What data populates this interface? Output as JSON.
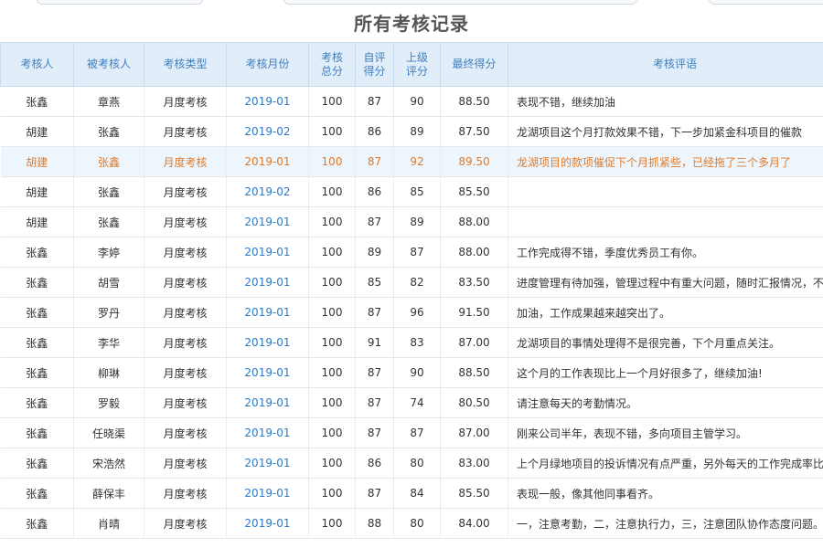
{
  "page": {
    "title": "所有考核记录"
  },
  "colors": {
    "header_bg": "#e1eefa",
    "header_text": "#3f7fbf",
    "month_link": "#2e7bc4",
    "highlight_text": "#e07a2a",
    "highlight_bg": "#eef6fd"
  },
  "table": {
    "headers": {
      "assessor": "考核人",
      "assessee": "被考核人",
      "type": "考核类型",
      "month": "考核月份",
      "total_1": "考核",
      "total_2": "总分",
      "self_1": "自评",
      "self_2": "得分",
      "sup_1": "上级",
      "sup_2": "评分",
      "final": "最终得分",
      "comment": "考核评语"
    },
    "rows": [
      {
        "assessor": "张鑫",
        "assessee": "章燕",
        "type": "月度考核",
        "month": "2019-01",
        "total": "100",
        "self": "87",
        "sup": "90",
        "final": "88.50",
        "comment": "表现不错，继续加油"
      },
      {
        "assessor": "胡建",
        "assessee": "张鑫",
        "type": "月度考核",
        "month": "2019-02",
        "total": "100",
        "self": "86",
        "sup": "89",
        "final": "87.50",
        "comment": "龙湖项目这个月打款效果不错，下一步加紧金科项目的催款"
      },
      {
        "assessor": "胡建",
        "assessee": "张鑫",
        "type": "月度考核",
        "month": "2019-01",
        "total": "100",
        "self": "87",
        "sup": "92",
        "final": "89.50",
        "comment": "龙湖项目的款项催促下个月抓紧些，已经拖了三个多月了"
      },
      {
        "assessor": "胡建",
        "assessee": "张鑫",
        "type": "月度考核",
        "month": "2019-02",
        "total": "100",
        "self": "86",
        "sup": "85",
        "final": "85.50",
        "comment": ""
      },
      {
        "assessor": "胡建",
        "assessee": "张鑫",
        "type": "月度考核",
        "month": "2019-01",
        "total": "100",
        "self": "87",
        "sup": "89",
        "final": "88.00",
        "comment": ""
      },
      {
        "assessor": "张鑫",
        "assessee": "李婷",
        "type": "月度考核",
        "month": "2019-01",
        "total": "100",
        "self": "89",
        "sup": "87",
        "final": "88.00",
        "comment": "工作完成得不错，季度优秀员工有你。"
      },
      {
        "assessor": "张鑫",
        "assessee": "胡雪",
        "type": "月度考核",
        "month": "2019-01",
        "total": "100",
        "self": "85",
        "sup": "82",
        "final": "83.50",
        "comment": "进度管理有待加强，管理过程中有重大问题，随时汇报情况，不要"
      },
      {
        "assessor": "张鑫",
        "assessee": "罗丹",
        "type": "月度考核",
        "month": "2019-01",
        "total": "100",
        "self": "87",
        "sup": "96",
        "final": "91.50",
        "comment": "加油，工作成果越来越突出了。"
      },
      {
        "assessor": "张鑫",
        "assessee": "李华",
        "type": "月度考核",
        "month": "2019-01",
        "total": "100",
        "self": "91",
        "sup": "83",
        "final": "87.00",
        "comment": "龙湖项目的事情处理得不是很完善，下个月重点关注。"
      },
      {
        "assessor": "张鑫",
        "assessee": "柳琳",
        "type": "月度考核",
        "month": "2019-01",
        "total": "100",
        "self": "87",
        "sup": "90",
        "final": "88.50",
        "comment": "这个月的工作表现比上一个月好很多了，继续加油!"
      },
      {
        "assessor": "张鑫",
        "assessee": "罗毅",
        "type": "月度考核",
        "month": "2019-01",
        "total": "100",
        "self": "87",
        "sup": "74",
        "final": "80.50",
        "comment": "请注意每天的考勤情况。"
      },
      {
        "assessor": "张鑫",
        "assessee": "任晓渠",
        "type": "月度考核",
        "month": "2019-01",
        "total": "100",
        "self": "87",
        "sup": "87",
        "final": "87.00",
        "comment": "刚来公司半年，表现不错，多向项目主管学习。"
      },
      {
        "assessor": "张鑫",
        "assessee": "宋浩然",
        "type": "月度考核",
        "month": "2019-01",
        "total": "100",
        "self": "86",
        "sup": "80",
        "final": "83.00",
        "comment": "上个月绿地项目的投诉情况有点严重，另外每天的工作完成率比较"
      },
      {
        "assessor": "张鑫",
        "assessee": "薛保丰",
        "type": "月度考核",
        "month": "2019-01",
        "total": "100",
        "self": "87",
        "sup": "84",
        "final": "85.50",
        "comment": "表现一般，像其他同事看齐。"
      },
      {
        "assessor": "张鑫",
        "assessee": "肖晴",
        "type": "月度考核",
        "month": "2019-01",
        "total": "100",
        "self": "88",
        "sup": "80",
        "final": "84.00",
        "comment": "一，注意考勤，二，注意执行力，三，注意团队协作态度问题。"
      }
    ]
  }
}
